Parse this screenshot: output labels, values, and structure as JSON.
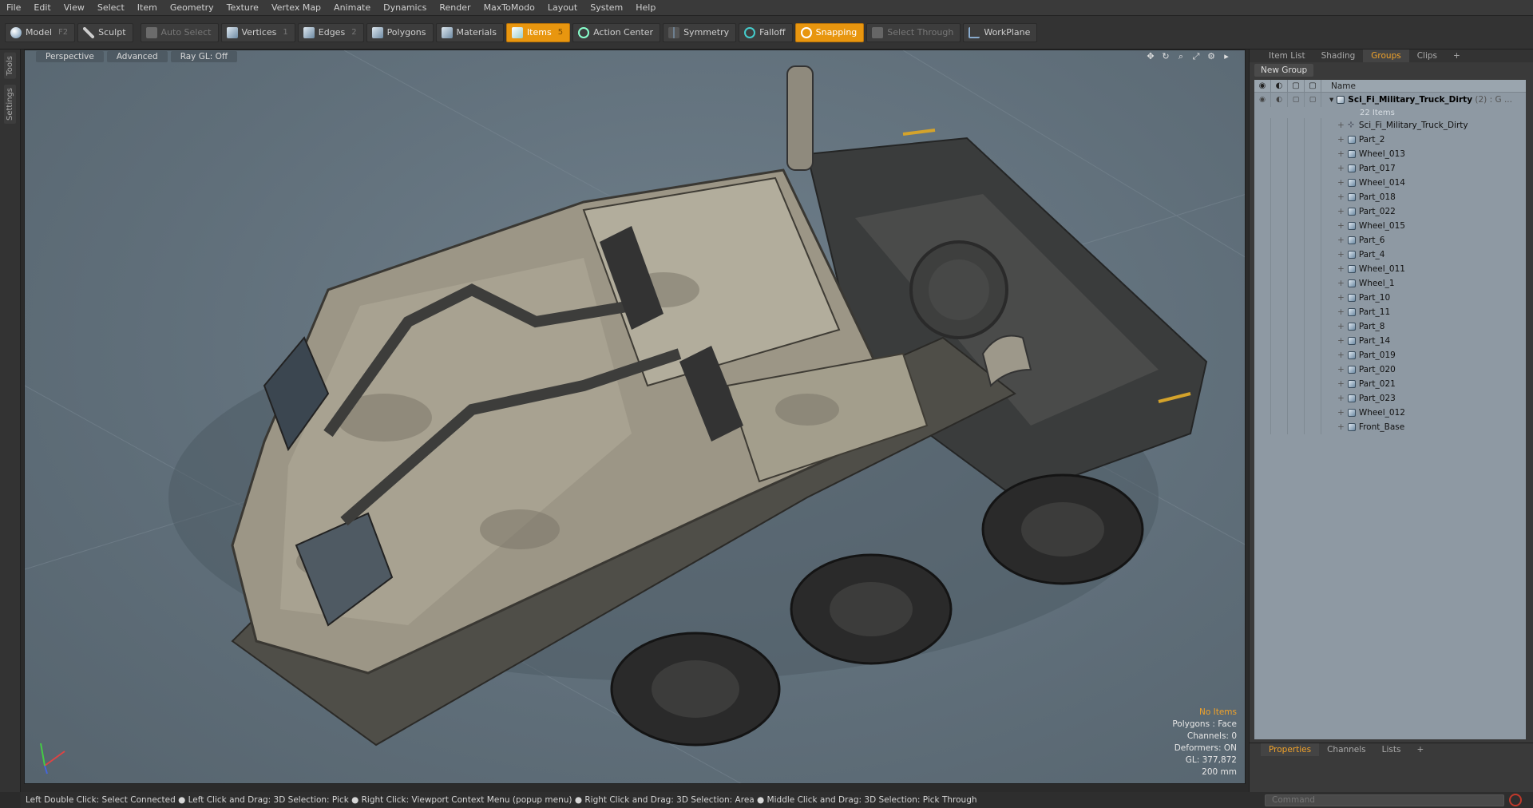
{
  "menu": [
    "File",
    "Edit",
    "View",
    "Select",
    "Item",
    "Geometry",
    "Texture",
    "Vertex Map",
    "Animate",
    "Dynamics",
    "Render",
    "MaxToModo",
    "Layout",
    "System",
    "Help"
  ],
  "toolbar": {
    "model": "Model",
    "model_key": "F2",
    "sculpt": "Sculpt",
    "auto_select": "Auto Select",
    "vertices": "Vertices",
    "vertices_num": "1",
    "edges": "Edges",
    "edges_num": "2",
    "polygons": "Polygons",
    "materials": "Materials",
    "items": "Items",
    "items_num": "5",
    "action_center": "Action Center",
    "symmetry": "Symmetry",
    "falloff": "Falloff",
    "snapping": "Snapping",
    "select_through": "Select Through",
    "workplane": "WorkPlane"
  },
  "lefttabs": [
    "Tools",
    "Settings"
  ],
  "viewport": {
    "perspective": "Perspective",
    "advanced": "Advanced",
    "raygl": "Ray GL: Off",
    "info": {
      "no_items": "No Items",
      "polygons": "Polygons : Face",
      "channels": "Channels: 0",
      "deformers": "Deformers: ON",
      "gl": "GL: 377,872",
      "scale": "200 mm"
    }
  },
  "rpanel": {
    "tabs": [
      "Item List",
      "Shading",
      "Groups",
      "Clips"
    ],
    "active_tab": "Groups",
    "new_group": "New Group",
    "col_name": "Name",
    "group": {
      "name": "Sci_Fi_Military_Truck_Dirty",
      "suffix": "(2) : G ...",
      "count": "22 Items"
    },
    "items": [
      "Sci_Fi_Military_Truck_Dirty",
      "Part_2",
      "Wheel_013",
      "Part_017",
      "Wheel_014",
      "Part_018",
      "Part_022",
      "Wheel_015",
      "Part_6",
      "Part_4",
      "Wheel_011",
      "Wheel_1",
      "Part_10",
      "Part_11",
      "Part_8",
      "Part_14",
      "Part_019",
      "Part_020",
      "Part_021",
      "Part_023",
      "Wheel_012",
      "Front_Base"
    ]
  },
  "ppanel": {
    "tabs": [
      "Properties",
      "Channels",
      "Lists"
    ],
    "active": "Properties"
  },
  "status": "Left Double Click: Select Connected ● Left Click and Drag: 3D Selection: Pick ● Right Click: Viewport Context Menu (popup menu) ● Right Click and Drag: 3D Selection: Area ● Middle Click and Drag: 3D Selection: Pick Through",
  "command_placeholder": "Command",
  "colors": {
    "accent": "#e8960f",
    "viewport_bg": "#5f6e79",
    "list_bg": "#8e99a3"
  }
}
